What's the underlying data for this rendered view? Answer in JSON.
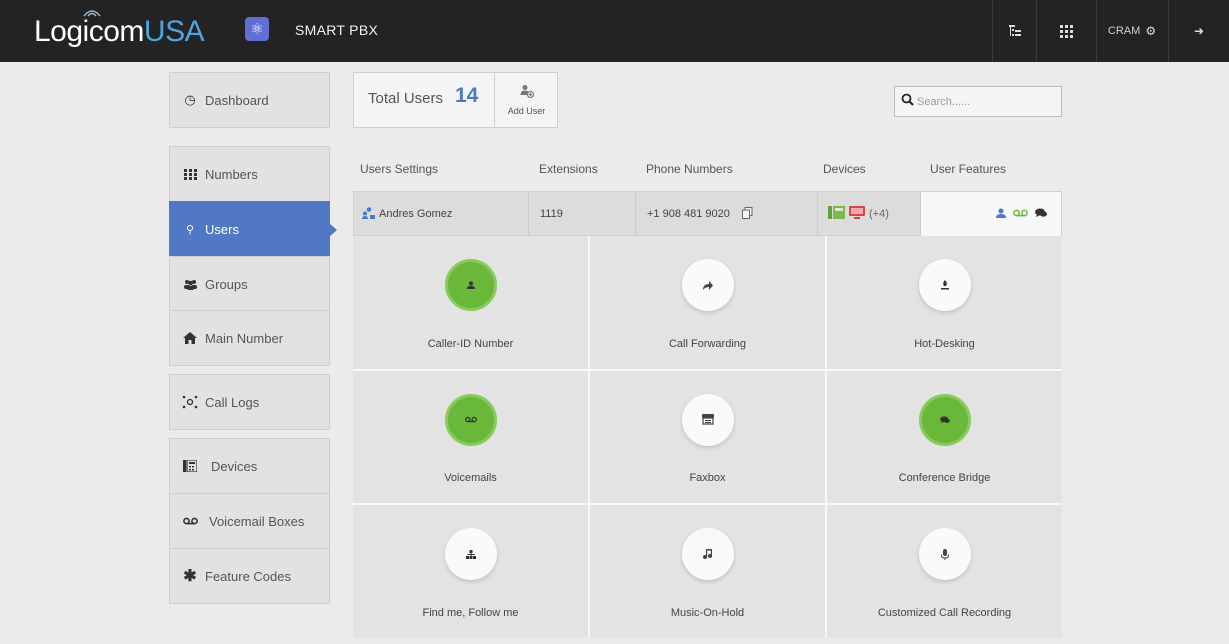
{
  "header": {
    "logo_part1": "Logicom",
    "logo_part2": "USA",
    "app_title": "SMART PBX",
    "user_label": "CRAM"
  },
  "sidebar": {
    "items": [
      {
        "label": "Dashboard",
        "icon": "dashboard-icon"
      },
      {
        "label": "Numbers",
        "icon": "grid-icon"
      },
      {
        "label": "Users",
        "icon": "users-icon",
        "active": true
      },
      {
        "label": "Groups",
        "icon": "groups-icon"
      },
      {
        "label": "Main Number",
        "icon": "home-icon"
      },
      {
        "label": "Call Logs",
        "icon": "call-logs-icon"
      },
      {
        "label": "Devices",
        "icon": "devices-icon"
      },
      {
        "label": "Voicemail Boxes",
        "icon": "voicemail-icon"
      },
      {
        "label": "Feature Codes",
        "icon": "asterisk-icon"
      }
    ]
  },
  "summary": {
    "total_label": "Total Users",
    "total_count": "14",
    "add_user_label": "Add User"
  },
  "search": {
    "placeholder": "Search......"
  },
  "table": {
    "headers": [
      "Users Settings",
      "Extensions",
      "Phone Numbers",
      "Devices",
      "User Features"
    ],
    "row": {
      "name": "Andres Gomez",
      "extension": "1119",
      "phone": "+1 908 481 9020",
      "devices_extra": "(+4)"
    }
  },
  "features": [
    {
      "label": "Caller-ID Number",
      "icon": "user-icon",
      "enabled": true
    },
    {
      "label": "Call Forwarding",
      "icon": "forward-icon",
      "enabled": false
    },
    {
      "label": "Hot-Desking",
      "icon": "hot-desk-icon",
      "enabled": false
    },
    {
      "label": "Voicemails",
      "icon": "voicemail-icon",
      "enabled": true
    },
    {
      "label": "Faxbox",
      "icon": "fax-icon",
      "enabled": false
    },
    {
      "label": "Conference Bridge",
      "icon": "comments-icon",
      "enabled": true
    },
    {
      "label": "Find me, Follow me",
      "icon": "sitemap-icon",
      "enabled": false
    },
    {
      "label": "Music-On-Hold",
      "icon": "music-icon",
      "enabled": false
    },
    {
      "label": "Customized Call Recording",
      "icon": "microphone-icon",
      "enabled": false
    }
  ],
  "colors": {
    "topbar": "#232323",
    "accent_blue": "#5178c4",
    "logo_blue": "#4ea3e0",
    "feature_on": "#6ab839"
  }
}
